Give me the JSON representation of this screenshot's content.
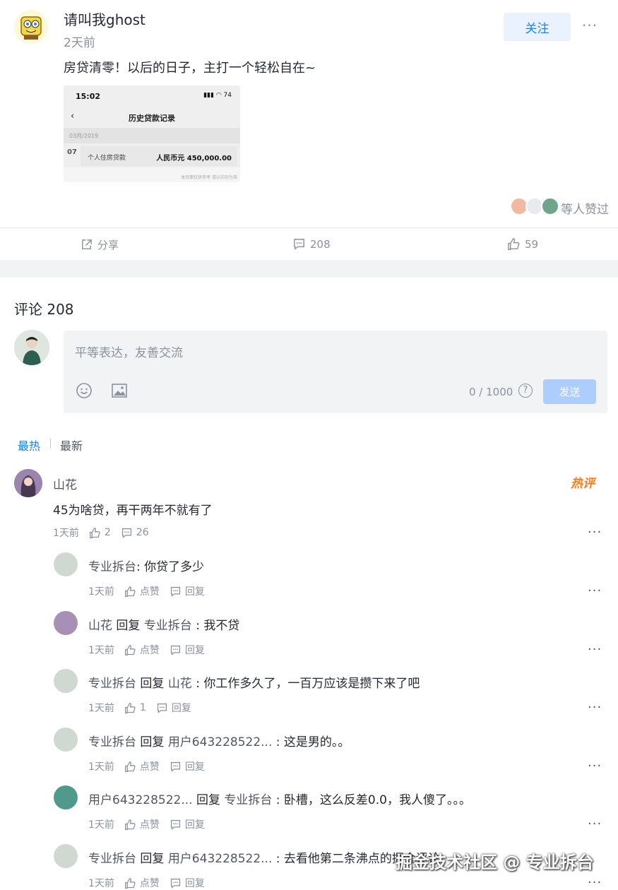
{
  "post": {
    "author": "请叫我ghost",
    "time": "2天前",
    "follow_label": "关注",
    "more": "···",
    "text": "房贷清零！以后的日子，主打一个轻松自在~",
    "screenshot": {
      "clock": "15:02",
      "status": "▮▮▮ ◠ 74",
      "back": "‹",
      "title": "历史贷款记录",
      "month": "03月/2019",
      "day": "07",
      "label": "个人住房贷款",
      "amount": "人民币元 450,000.00",
      "footer": "本页面仅供参考 请以实际为准"
    },
    "likers_text": "等人赞过",
    "actions": {
      "share": "分享",
      "comments": "208",
      "likes": "59"
    }
  },
  "comments_section": {
    "title": "评论 208",
    "placeholder": "平等表达，友善交流",
    "counter": "0 / 1000",
    "help": "?",
    "send": "发送",
    "sort_hot": "最热",
    "sort_new": "最新",
    "hot_badge": "热评"
  },
  "top_comment": {
    "name": "山花",
    "text": "45为啥贷，再干两年不就有了",
    "time": "1天前",
    "likes": "2",
    "replies": "26"
  },
  "replies": [
    {
      "name": "专业拆台",
      "reply_word": "",
      "target": "",
      "text": ": 你贷了多少",
      "time": "1天前",
      "like": "点赞",
      "reply": "回复"
    },
    {
      "name": "山花",
      "reply_word": " 回复 ",
      "target": "专业拆台",
      "text": " : 我不贷",
      "time": "1天前",
      "like": "点赞",
      "reply": "回复"
    },
    {
      "name": "专业拆台",
      "reply_word": " 回复 ",
      "target": "山花",
      "text": " : 你工作多久了，一百万应该是攒下来了吧",
      "time": "1天前",
      "like": "1",
      "reply": "回复"
    },
    {
      "name": "专业拆台",
      "reply_word": " 回复 ",
      "target": "用户643228522...",
      "text": "   : 这是男的。。",
      "time": "1天前",
      "like": "点赞",
      "reply": "回复"
    },
    {
      "name": "用户643228522...",
      "reply_word": "   回复 ",
      "target": "专业拆台",
      "text": " : 卧槽，这么反差0.0，我人傻了。。。",
      "time": "1天前",
      "like": "点赞",
      "reply": "回复"
    },
    {
      "name": "专业拆台",
      "reply_word": " 回复 ",
      "target": "用户643228522...",
      "text": "   : 去看他第二条沸点的掘金评论",
      "time": "1天前",
      "like": "点赞",
      "reply": "回复"
    }
  ],
  "watermark": "掘金技术社区 @ 专业拆台",
  "colors": {
    "accent": "#1e80ff",
    "muted": "#8a919f",
    "hot": "#ff7a1a"
  }
}
